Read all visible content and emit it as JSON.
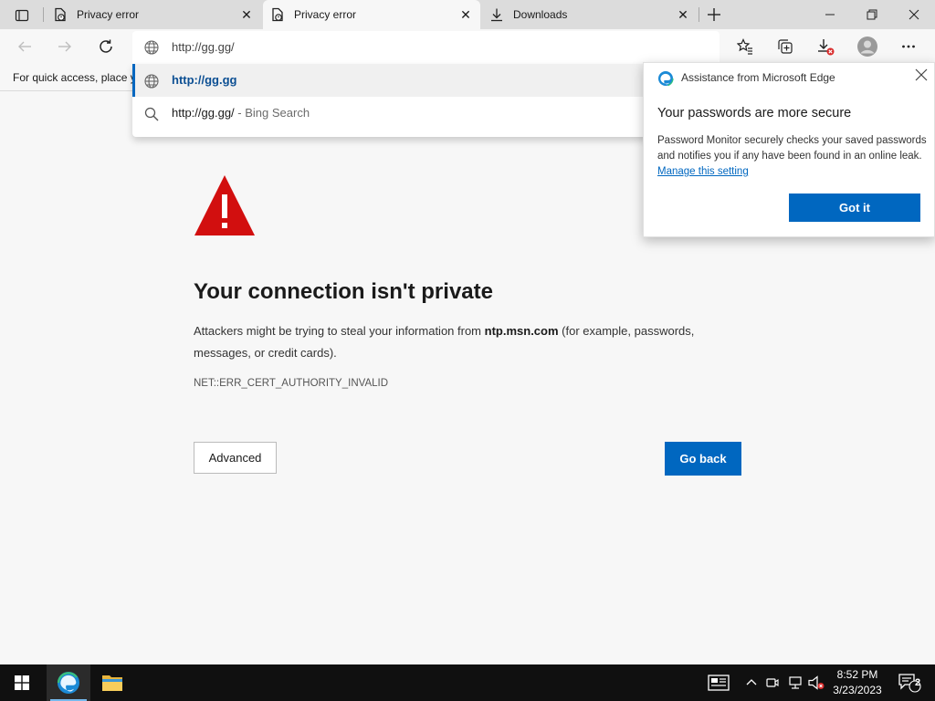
{
  "tabs": [
    {
      "label": "Privacy error",
      "active": false
    },
    {
      "label": "Privacy error",
      "active": true
    },
    {
      "label": "Downloads",
      "active": false
    }
  ],
  "address": {
    "value": "http://gg.gg/"
  },
  "favbar": {
    "hint": "For quick access, place y"
  },
  "suggestions": [
    {
      "text": "http://gg.gg",
      "icon": "globe-icon",
      "selected": true
    },
    {
      "text": "http://gg.gg/",
      "suffix": " - Bing Search",
      "icon": "search-icon",
      "selected": false
    }
  ],
  "page": {
    "heading": "Your connection isn't private",
    "para_before": "Attackers might be trying to steal your information from ",
    "para_domain": "ntp.msn.com",
    "para_after": " (for example, passwords, messages, or credit cards).",
    "error_code": "NET::ERR_CERT_AUTHORITY_INVALID",
    "advanced_label": "Advanced",
    "goback_label": "Go back"
  },
  "flyout": {
    "title": "Assistance from Microsoft Edge",
    "heading": "Your passwords are more secure",
    "body": "Password Monitor securely checks your saved passwords and notifies you if any have been found in an online leak. ",
    "link": "Manage this setting",
    "button": "Got it"
  },
  "taskbar": {
    "time": "8:52 PM",
    "date": "3/23/2023",
    "notification_count": "2"
  },
  "colors": {
    "accent": "#0067c0",
    "warning": "#d20f0f",
    "taskbar": "#101010"
  }
}
